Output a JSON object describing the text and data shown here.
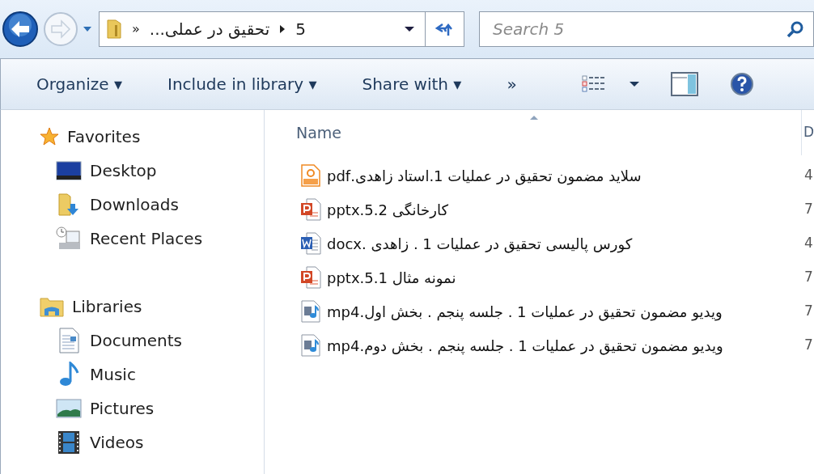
{
  "navigation": {
    "breadcrumb": {
      "overflow_chevron": "»",
      "parent_folder": "تحقیق در عملی...",
      "current_folder": "5"
    },
    "search": {
      "placeholder": "Search 5"
    }
  },
  "toolbar": {
    "organize_menu": "Organize ▾",
    "include_in_library_menu": "Include in library ▾",
    "share_with_menu": "Share with ▾",
    "more_button": "»"
  },
  "sidebar": {
    "groups": [
      {
        "label": "Favorites",
        "children": [
          {
            "label": "Desktop"
          },
          {
            "label": "Downloads"
          },
          {
            "label": "Recent Places"
          }
        ]
      },
      {
        "label": "Libraries",
        "children": [
          {
            "label": "Documents"
          },
          {
            "label": "Music"
          },
          {
            "label": "Pictures"
          },
          {
            "label": "Videos"
          }
        ]
      }
    ]
  },
  "file_list": {
    "name_column": {
      "label": "Name",
      "sorted": true
    },
    "column_2": {
      "label": "D"
    },
    "rows": [
      {
        "kind": "pdf",
        "name": "سلاید مضمون تحقیق در عملیات 1.استاد زاهدی.pdf",
        "column_2": "4"
      },
      {
        "kind": "pptx",
        "name": "کارخانگی 5.2.pptx",
        "column_2": "7"
      },
      {
        "kind": "docx",
        "name": "کورس پالیسی تحقیق در عملیات 1 . زاهدی .docx",
        "column_2": "4"
      },
      {
        "kind": "pptx",
        "name": "نمونه مثال 5.1.pptx",
        "column_2": "7"
      },
      {
        "kind": "video",
        "name": "ویدیو مضمون تحقیق در عملیات 1 . جلسه پنجم . بخش اول.mp4",
        "column_2": "7"
      },
      {
        "kind": "video",
        "name": "ویدیو مضمون تحقیق در عملیات 1 . جلسه پنجم . بخش دوم.mp4",
        "column_2": "7"
      }
    ]
  }
}
